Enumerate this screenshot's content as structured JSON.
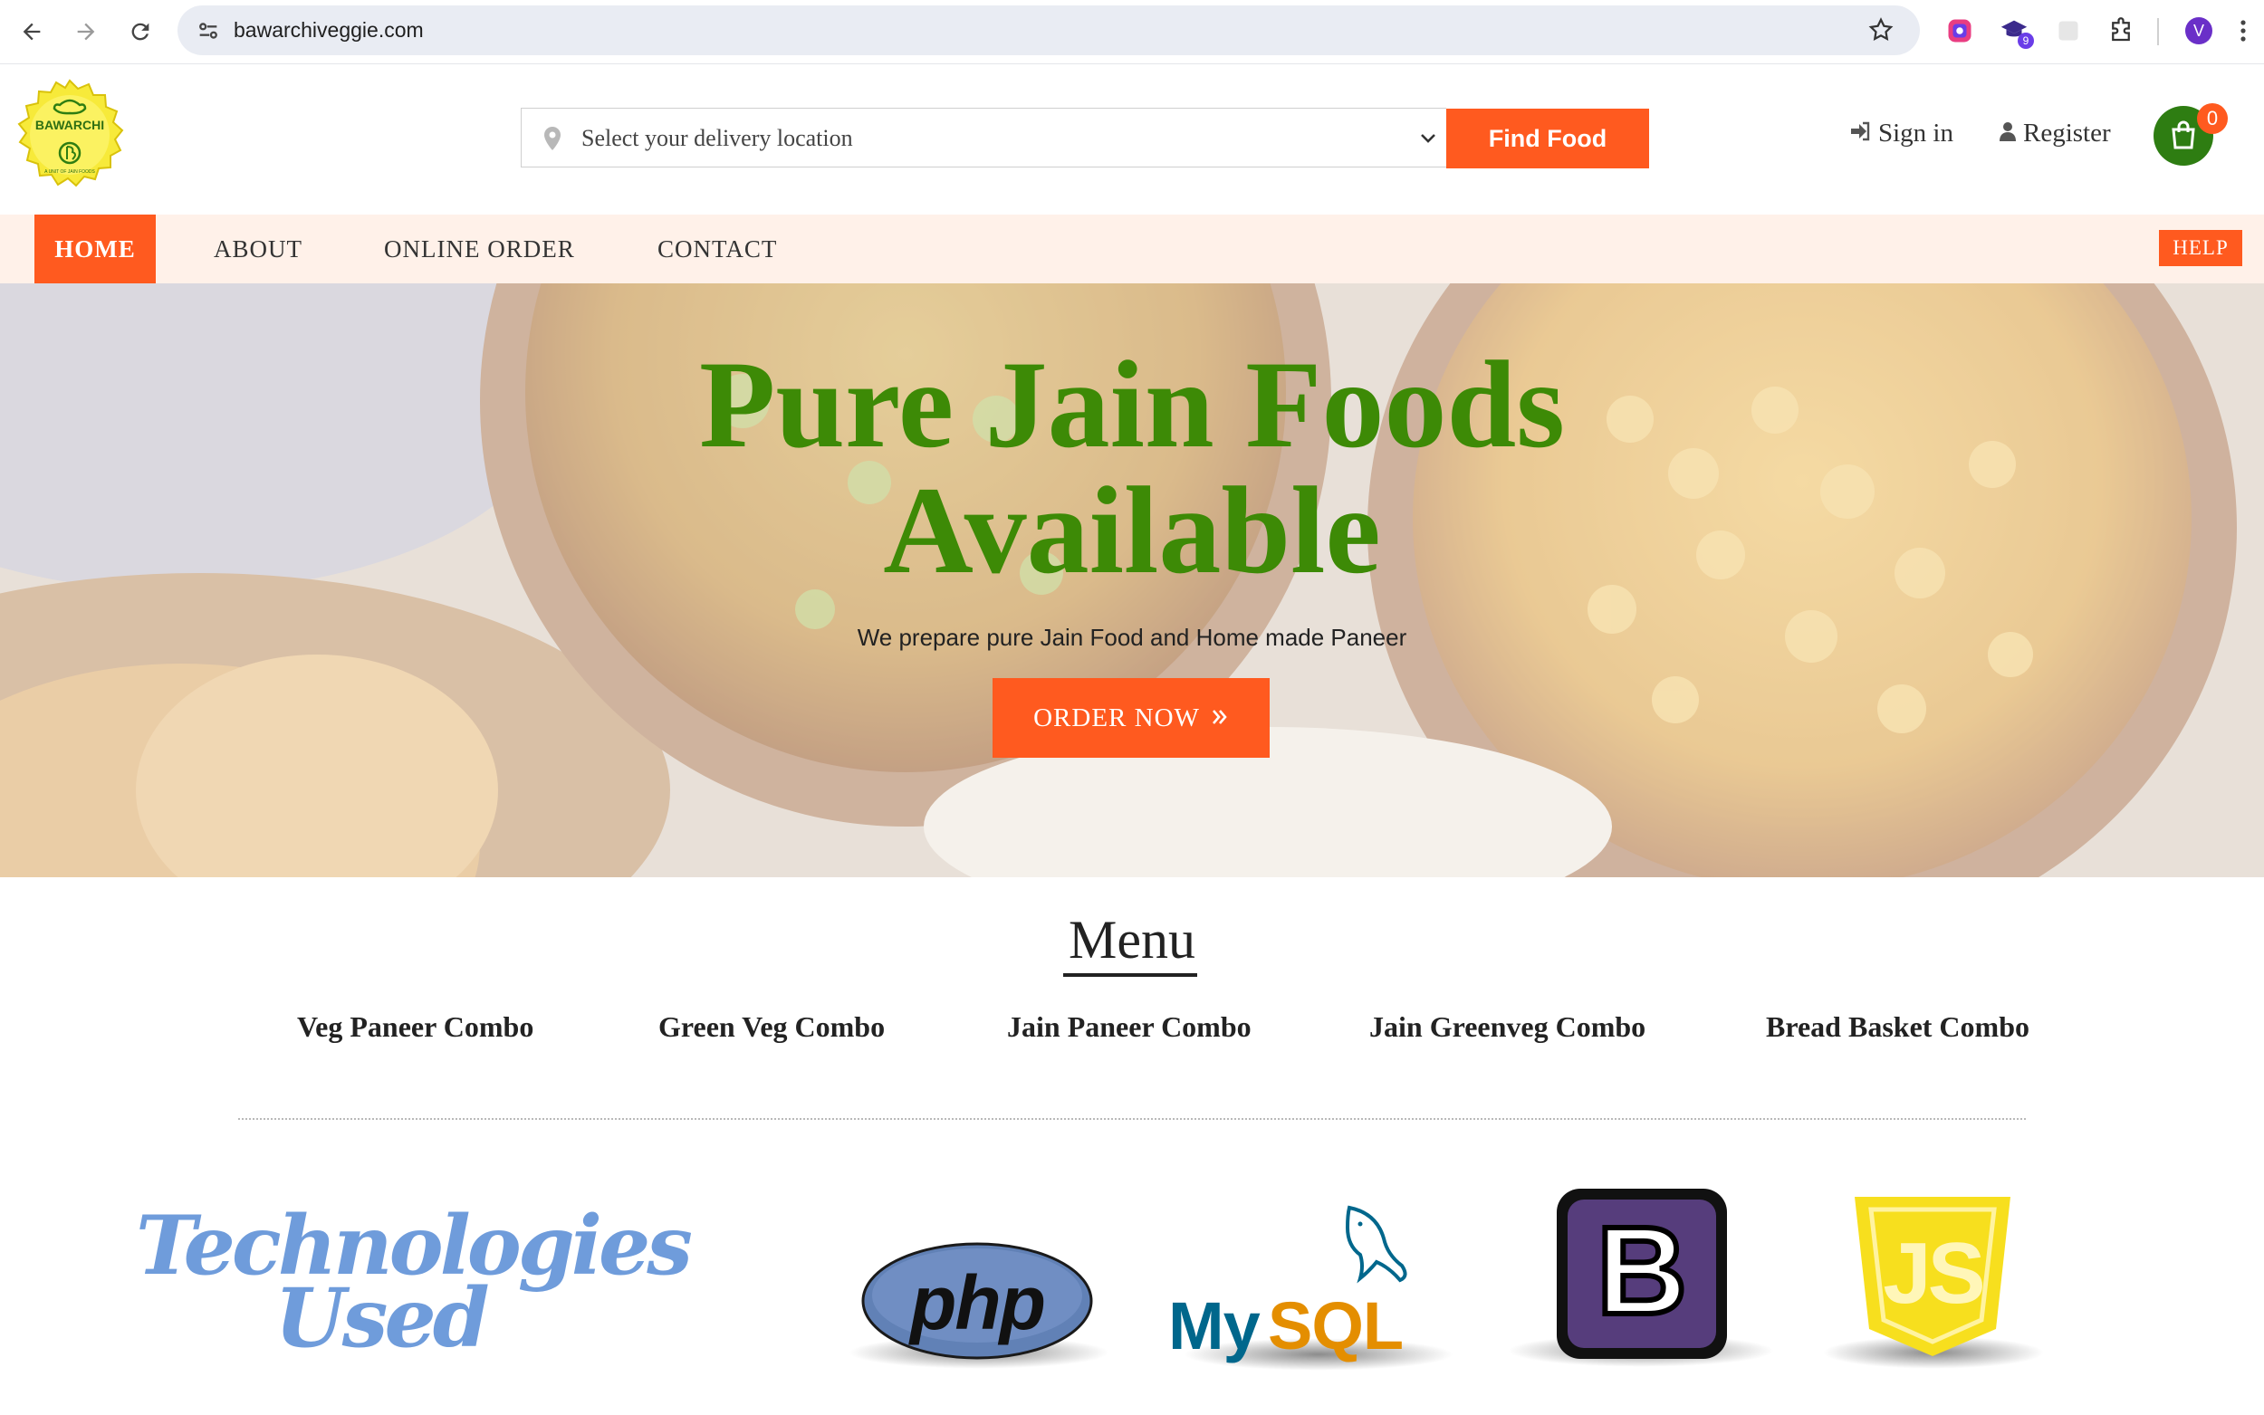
{
  "browser": {
    "url": "bawarchiveggie.com",
    "profile_initial": "V",
    "extension_badge": "9"
  },
  "header": {
    "logo_text": "BAWARCHI",
    "logo_tagline": "A UNIT OF JAIN FOODS",
    "location_placeholder": "Select your delivery location",
    "find_button": "Find Food",
    "sign_in": "Sign in",
    "register": "Register",
    "cart_count": "0"
  },
  "nav": {
    "items": [
      "HOME",
      "ABOUT",
      "ONLINE ORDER",
      "CONTACT"
    ],
    "help": "HELP"
  },
  "hero": {
    "title_line1": "Pure Jain Foods",
    "title_line2": "Available",
    "subtitle": "We prepare pure Jain Food and Home made Paneer",
    "cta": "ORDER NOW"
  },
  "menu": {
    "title": "Menu",
    "items": [
      "Veg Paneer Combo",
      "Green Veg Combo",
      "Jain Paneer Combo",
      "Jain Greenveg Combo",
      "Bread Basket Combo"
    ]
  },
  "technologies": {
    "title_line1": "Technologies",
    "title_line2": "Used",
    "logos": [
      "PHP",
      "MySQL",
      "Bootstrap",
      "JavaScript"
    ],
    "php_text": "php",
    "mysql_text_a": "My",
    "mysql_text_b": "SQL",
    "bootstrap_letter": "B",
    "js_text": "JS"
  },
  "colors": {
    "accent": "#ff5a1f",
    "hero_title": "#3d8a06",
    "cart": "#2e7d12",
    "nav_bg": "#fff1e9"
  }
}
